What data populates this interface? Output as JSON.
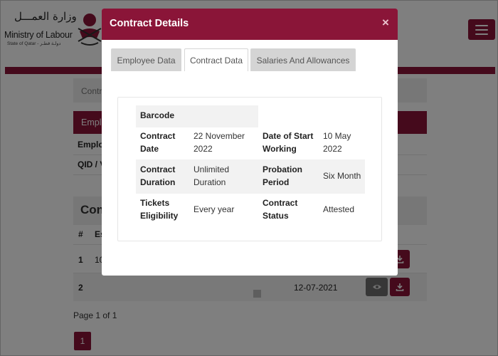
{
  "background": {
    "logo": {
      "arabic_text": "وزارة العمـــل",
      "english_text": "Ministry of Labour",
      "subtitle": "State of Qatar - دولـة قطـر"
    },
    "breadcrumb_partial": "Contr",
    "employee_header_partial": "Emplo",
    "employee_row1_partial": "Employ",
    "employee_row2_partial": "QID / V",
    "contracts_title_partial": "Con",
    "table_header": {
      "hash": "#",
      "second_partial": "Es"
    },
    "rows": [
      {
        "num": "1",
        "value_partial": "10",
        "date": ""
      },
      {
        "num": "2",
        "value_partial": "",
        "date": "12-07-2021"
      }
    ],
    "pagination_info": "Page 1 of 1",
    "current_page": "1"
  },
  "modal": {
    "title": "Contract Details",
    "close_symbol": "×",
    "tabs": [
      {
        "label": "Employee Data",
        "active": false
      },
      {
        "label": "Contract Data",
        "active": true
      },
      {
        "label": "Salaries And Allowances",
        "active": false
      }
    ],
    "fields": {
      "barcode": {
        "label": "Barcode",
        "value": ""
      },
      "contract_date": {
        "label": "Contract Date",
        "value": "22 November 2022"
      },
      "start_date": {
        "label": "Date of Start Working",
        "value": "10 May 2022"
      },
      "contract_duration": {
        "label": "Contract Duration",
        "value": "Unlimited Duration"
      },
      "probation_period": {
        "label": "Probation Period",
        "value": "Six Month"
      },
      "tickets_eligibility": {
        "label": "Tickets Eligibility",
        "value": "Every year"
      },
      "contract_status": {
        "label": "Contract Status",
        "value": "Attested"
      }
    }
  },
  "colors": {
    "brand": "#8a1538",
    "overlay": "rgba(0,0,0,0.5)"
  },
  "icons": [
    "hamburger-menu-icon",
    "eye-icon",
    "download-icon",
    "close-icon",
    "qatar-emblem-icon"
  ]
}
